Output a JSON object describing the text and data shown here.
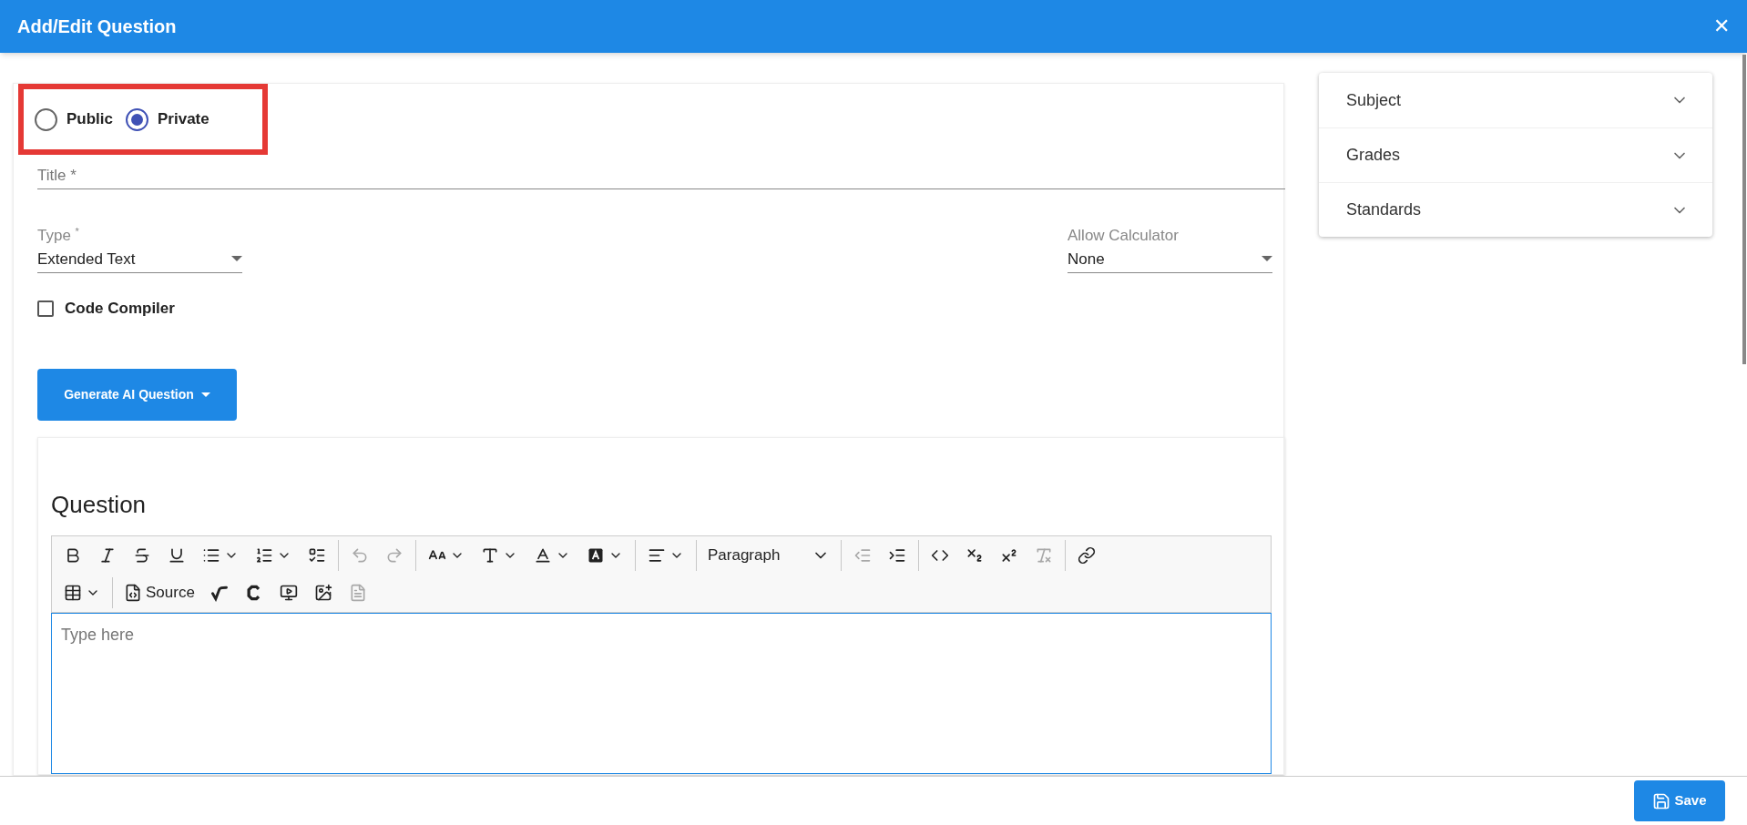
{
  "window": {
    "title": "Add/Edit Question",
    "close": "✕"
  },
  "visibility": [
    {
      "label": "Public",
      "selected": false
    },
    {
      "label": "Private",
      "selected": true
    }
  ],
  "title_field": {
    "placeholder": "Title *"
  },
  "type_select": {
    "label": "Type",
    "required": "*",
    "value": "Extended Text"
  },
  "calculator_select": {
    "label": "Allow Calculator",
    "value": "None"
  },
  "code_compiler": {
    "label": "Code Compiler",
    "checked": false
  },
  "generate_button": {
    "label": "Generate AI Question"
  },
  "question": {
    "heading": "Question",
    "placeholder": "Type here"
  },
  "toolbar": {
    "rows": [
      [
        {
          "kind": "bold",
          "disabled": false
        },
        {
          "kind": "italic",
          "disabled": false
        },
        {
          "kind": "strikethrough",
          "disabled": false
        },
        {
          "kind": "underline",
          "disabled": false
        },
        {
          "kind": "bullets",
          "disabled": false
        },
        {
          "kind": "numbers",
          "disabled": false
        },
        {
          "kind": "todo",
          "disabled": false
        },
        {
          "kind": "separator"
        },
        {
          "kind": "undo",
          "disabled": true
        },
        {
          "kind": "redo",
          "disabled": true
        },
        {
          "kind": "separator"
        },
        {
          "kind": "font-size",
          "disabled": false
        },
        {
          "kind": "font-family",
          "disabled": false
        },
        {
          "kind": "font-color",
          "disabled": false
        },
        {
          "kind": "font-background",
          "disabled": false
        },
        {
          "kind": "separator"
        },
        {
          "kind": "align",
          "disabled": false
        },
        {
          "kind": "separator"
        },
        {
          "kind": "heading",
          "label": "Paragraph"
        },
        {
          "kind": "separator"
        },
        {
          "kind": "outdent",
          "disabled": true
        },
        {
          "kind": "indent",
          "disabled": false
        },
        {
          "kind": "separator"
        },
        {
          "kind": "code",
          "disabled": false
        },
        {
          "kind": "subscript",
          "disabled": false
        },
        {
          "kind": "superscript",
          "disabled": false
        },
        {
          "kind": "remove-format",
          "disabled": true
        },
        {
          "kind": "separator"
        },
        {
          "kind": "link",
          "disabled": false
        }
      ],
      [
        {
          "kind": "table",
          "disabled": false
        },
        {
          "kind": "separator"
        },
        {
          "kind": "source",
          "label": "Source"
        },
        {
          "kind": "math",
          "disabled": false
        },
        {
          "kind": "chem",
          "disabled": false
        },
        {
          "kind": "media",
          "disabled": false
        },
        {
          "kind": "image",
          "disabled": false
        },
        {
          "kind": "file",
          "disabled": true
        }
      ]
    ]
  },
  "filters": [
    {
      "label": "Subject",
      "expanded": false
    },
    {
      "label": "Grades",
      "expanded": false
    },
    {
      "label": "Standards",
      "expanded": false
    }
  ],
  "save_button": {
    "label": "Save"
  }
}
